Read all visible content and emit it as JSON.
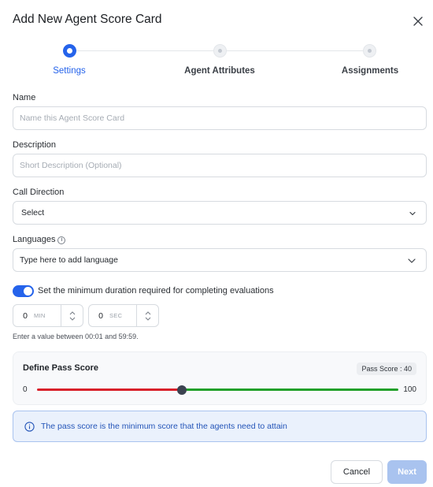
{
  "dialog": {
    "title": "Add New Agent Score Card",
    "close_icon": "close-icon"
  },
  "stepper": {
    "steps": [
      {
        "label": "Settings",
        "state": "active"
      },
      {
        "label": "Agent Attributes",
        "state": "pending"
      },
      {
        "label": "Assignments",
        "state": "pending"
      }
    ]
  },
  "form": {
    "name": {
      "label": "Name",
      "placeholder": "Name this Agent Score Card",
      "value": ""
    },
    "description": {
      "label": "Description",
      "placeholder": "Short Description (Optional)",
      "value": ""
    },
    "call_direction": {
      "label": "Call Direction",
      "selected": "Select"
    },
    "languages": {
      "label": "Languages",
      "placeholder": "Type here to add language",
      "info_icon": "info-icon"
    },
    "min_duration": {
      "toggle_on": true,
      "label": "Set the minimum duration required for completing evaluations",
      "minutes": "0",
      "minutes_unit": "MIN",
      "seconds": "0",
      "seconds_unit": "SEC",
      "hint": "Enter a value between 00:01 and 59:59."
    },
    "pass_score": {
      "title": "Define Pass Score",
      "badge": "Pass Score : 40",
      "min_label": "0",
      "max_label": "100",
      "value": 40,
      "min": 0,
      "max": 100,
      "fail_color": "#d8202a",
      "pass_color": "#22a02a"
    },
    "notice": {
      "text": "The pass score is the minimum score that the agents need to attain",
      "icon": "info-circle-icon"
    }
  },
  "footer": {
    "cancel_label": "Cancel",
    "next_label": "Next"
  },
  "colors": {
    "accent": "#2563eb",
    "next_disabled": "#a9c3ef"
  }
}
